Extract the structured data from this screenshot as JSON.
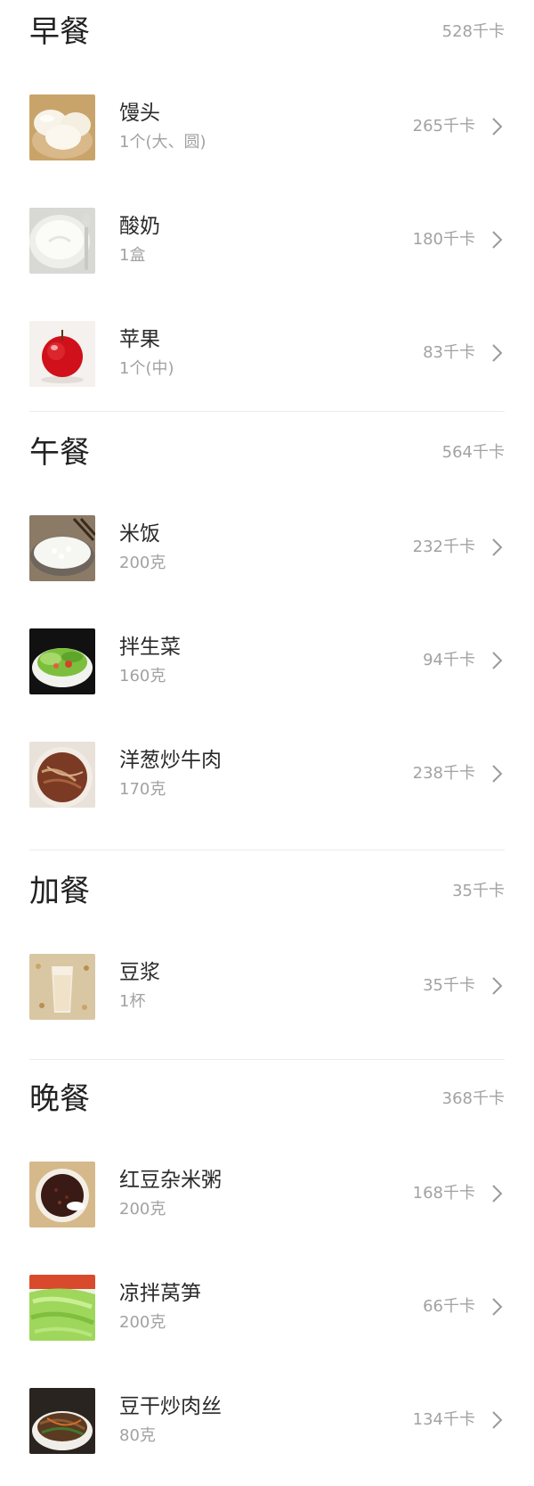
{
  "colors": {
    "title": "#222222",
    "text": "#2a2a2a",
    "muted": "#a2a2a2",
    "divider": "#ececec",
    "background": "#ffffff"
  },
  "sections": [
    {
      "title": "早餐",
      "total": "528千卡",
      "items": [
        {
          "name": "馒头",
          "portion": "1个(大、圆)",
          "kcal": "265千卡",
          "image": "steamed-bun"
        },
        {
          "name": "酸奶",
          "portion": "1盒",
          "kcal": "180千卡",
          "image": "yogurt"
        },
        {
          "name": "苹果",
          "portion": "1个(中)",
          "kcal": "83千卡",
          "image": "apple"
        }
      ]
    },
    {
      "title": "午餐",
      "total": "564千卡",
      "items": [
        {
          "name": "米饭",
          "portion": "200克",
          "kcal": "232千卡",
          "image": "rice"
        },
        {
          "name": "拌生菜",
          "portion": "160克",
          "kcal": "94千卡",
          "image": "salad"
        },
        {
          "name": "洋葱炒牛肉",
          "portion": "170克",
          "kcal": "238千卡",
          "image": "beef-onion"
        }
      ]
    },
    {
      "title": "加餐",
      "total": "35千卡",
      "items": [
        {
          "name": "豆浆",
          "portion": "1杯",
          "kcal": "35千卡",
          "image": "soy-milk"
        }
      ]
    },
    {
      "title": "晚餐",
      "total": "368千卡",
      "items": [
        {
          "name": "红豆杂米粥",
          "portion": "200克",
          "kcal": "168千卡",
          "image": "red-bean-porridge"
        },
        {
          "name": "凉拌莴笋",
          "portion": "200克",
          "kcal": "66千卡",
          "image": "lettuce-stem"
        },
        {
          "name": "豆干炒肉丝",
          "portion": "80克",
          "kcal": "134千卡",
          "image": "tofu-pork"
        }
      ]
    }
  ]
}
